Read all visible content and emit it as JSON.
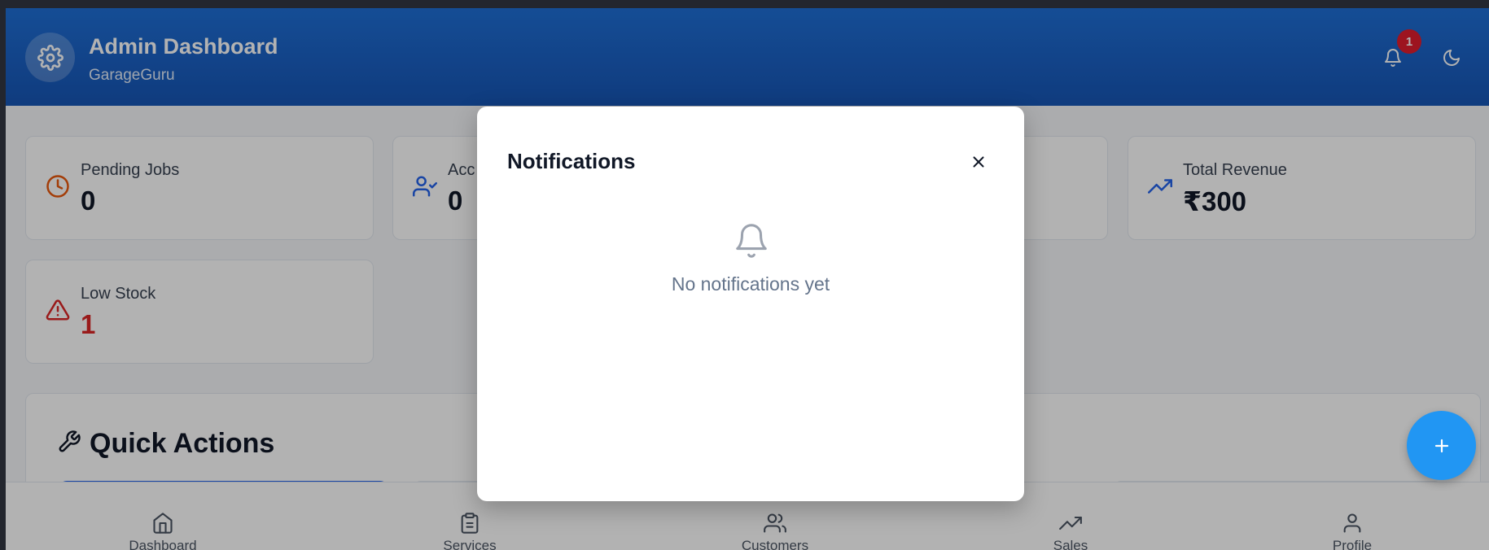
{
  "header": {
    "title": "Admin Dashboard",
    "subtitle": "GarageGuru",
    "logo_icon": "gear-icon",
    "notification_count": "1",
    "notification_icon": "bell-icon",
    "theme_icon": "moon-icon"
  },
  "stats": [
    {
      "label": "Pending Jobs",
      "value": "0",
      "icon": "clock-icon",
      "color": "#ea580c"
    },
    {
      "label": "Acc",
      "value": "0",
      "icon": "user-check-icon",
      "color": "#2563eb"
    },
    {
      "label": "Total Revenue",
      "value": "₹300",
      "icon": "trending-up-icon",
      "color": "#2563eb"
    },
    {
      "label": "Low Stock",
      "value": "1",
      "icon": "alert-triangle-icon",
      "color": "#dc2626"
    }
  ],
  "quick_actions": {
    "title": "Quick Actions",
    "icon": "wrench-icon"
  },
  "bottom_nav": [
    {
      "label": "Dashboard",
      "icon": "home-icon"
    },
    {
      "label": "Services",
      "icon": "clipboard-icon"
    },
    {
      "label": "Customers",
      "icon": "users-icon"
    },
    {
      "label": "Sales",
      "icon": "trending-up-icon"
    },
    {
      "label": "Profile",
      "icon": "user-icon"
    }
  ],
  "fab": {
    "icon": "plus-icon",
    "color": "#2196f3"
  },
  "modal": {
    "title": "Notifications",
    "empty_text": "No notifications yet",
    "close_icon": "close-icon",
    "empty_icon": "bell-icon"
  },
  "colors": {
    "header_primary": "#1a5fc2",
    "badge": "#e11d2e",
    "low_stock_value": "#dc2626"
  }
}
